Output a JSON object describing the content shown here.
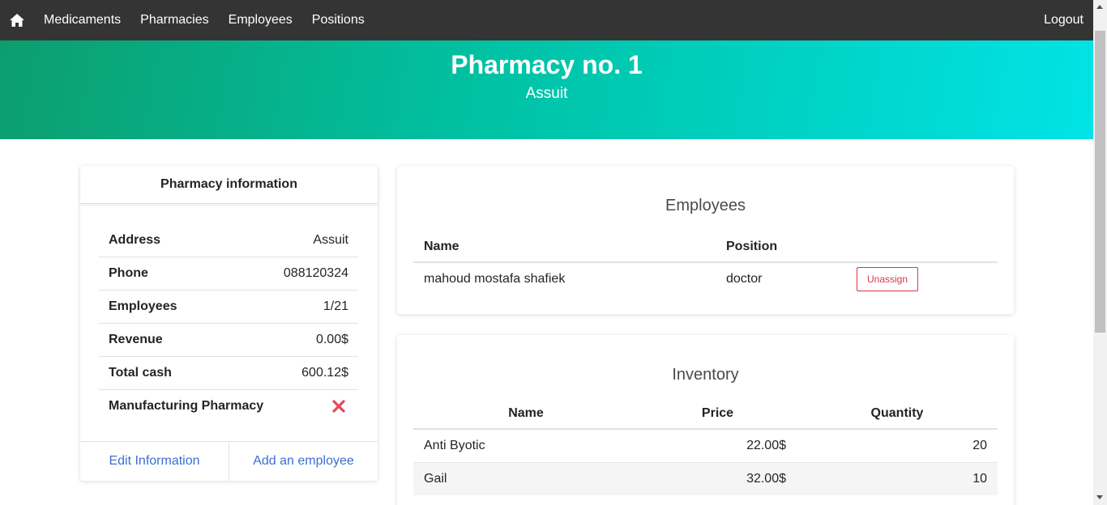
{
  "nav": {
    "home_icon": "home-icon",
    "links": [
      "Medicaments",
      "Pharmacies",
      "Employees",
      "Positions"
    ],
    "logout": "Logout"
  },
  "hero": {
    "title": "Pharmacy no. 1",
    "subtitle": "Assuit"
  },
  "info": {
    "header": "Pharmacy information",
    "rows": [
      {
        "label": "Address",
        "value": "Assuit"
      },
      {
        "label": "Phone",
        "value": "088120324"
      },
      {
        "label": "Employees",
        "value": "1/21"
      },
      {
        "label": "Revenue",
        "value": "0.00$"
      },
      {
        "label": "Total cash",
        "value": "600.12$"
      },
      {
        "label": "Manufacturing Pharmacy",
        "value_icon": "close-icon"
      }
    ],
    "edit_label": "Edit Information",
    "add_label": "Add an employee"
  },
  "employees": {
    "title": "Employees",
    "headers": [
      "Name",
      "Position"
    ],
    "rows": [
      {
        "name": "mahoud mostafa shafiek",
        "position": "doctor",
        "action": "Unassign"
      }
    ]
  },
  "inventory": {
    "title": "Inventory",
    "headers": [
      "Name",
      "Price",
      "Quantity"
    ],
    "rows": [
      {
        "name": "Anti Byotic",
        "price": "22.00$",
        "quantity": "20"
      },
      {
        "name": "Gail",
        "price": "32.00$",
        "quantity": "10"
      }
    ]
  },
  "colors": {
    "navbar": "#343434",
    "hero_start": "#0c9e6e",
    "hero_end": "#01e3e6",
    "link": "#3b6fd1",
    "danger": "#dc3545",
    "cross": "#e8455c"
  }
}
